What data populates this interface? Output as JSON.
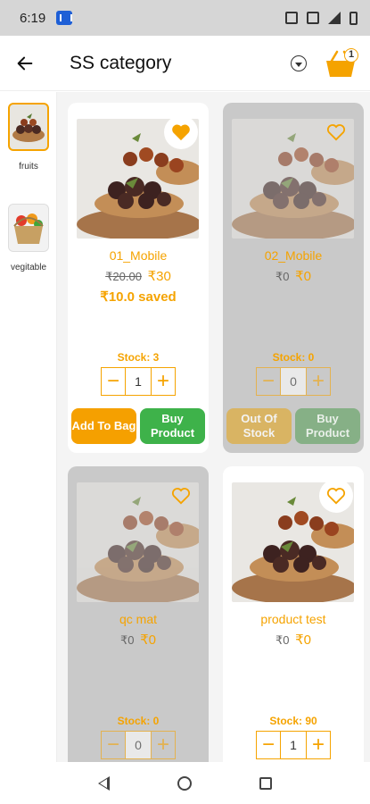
{
  "status_bar": {
    "time": "6:19"
  },
  "app_bar": {
    "title": "SS category",
    "cart_count": "1"
  },
  "sidebar": {
    "items": [
      {
        "label": "fruits",
        "active": true,
        "icon": "dates-bowl-image"
      },
      {
        "label": "vegitable",
        "active": false,
        "icon": "vegetable-basket-image"
      }
    ]
  },
  "products": [
    {
      "name": "01_Mobile",
      "old_price": "₹20.00",
      "new_price": "₹30",
      "saved": "₹10.0 saved",
      "stock": "Stock: 3",
      "qty": "1",
      "btn_left": "Add To Bag",
      "btn_right": "Buy Product",
      "favorite": true,
      "available": true
    },
    {
      "name": "02_Mobile",
      "old_price": "₹0",
      "new_price": "₹0",
      "saved": "",
      "stock": "Stock: 0",
      "qty": "0",
      "btn_left": "Out Of Stock",
      "btn_right": "Buy Product",
      "favorite": false,
      "available": false
    },
    {
      "name": "qc mat",
      "old_price": "₹0",
      "new_price": "₹0",
      "saved": "",
      "stock": "Stock: 0",
      "qty": "0",
      "favorite": false,
      "available": false
    },
    {
      "name": "product test",
      "old_price": "₹0",
      "new_price": "₹0",
      "saved": "",
      "stock": "Stock: 90",
      "qty": "1",
      "favorite": false,
      "available": true
    }
  ],
  "colors": {
    "accent": "#f5a300",
    "buy": "#3eb24a"
  }
}
